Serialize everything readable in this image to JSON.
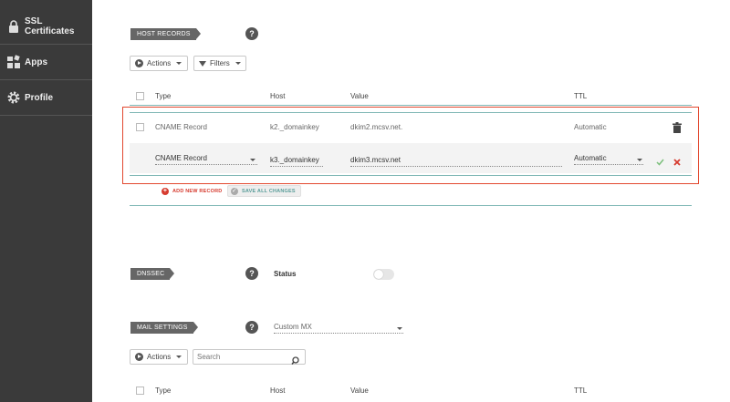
{
  "sidebar": {
    "items": [
      {
        "label": "SSL Certificates",
        "icon": "lock-icon"
      },
      {
        "label": "Apps",
        "icon": "apps-icon"
      },
      {
        "label": "Profile",
        "icon": "gear-icon"
      }
    ]
  },
  "host_records": {
    "tag": "HOST RECORDS",
    "help": "?",
    "actions_label": "Actions",
    "filters_label": "Filters",
    "columns": {
      "type": "Type",
      "host": "Host",
      "value": "Value",
      "ttl": "TTL"
    },
    "row": {
      "type": "CNAME Record",
      "host": "k2._domainkey",
      "value": "dkim2.mcsv.net.",
      "ttl": "Automatic"
    },
    "edit_row": {
      "type": "CNAME Record",
      "host": "k3._domainkey",
      "value": "dkim3.mcsv.net",
      "ttl": "Automatic"
    },
    "add_label": "ADD NEW RECORD",
    "save_label": "SAVE ALL CHANGES"
  },
  "dnssec": {
    "tag": "DNSSEC",
    "help": "?",
    "status_label": "Status",
    "enabled": false
  },
  "mail_settings": {
    "tag": "MAIL SETTINGS",
    "help": "?",
    "selected": "Custom MX",
    "actions_label": "Actions",
    "search_placeholder": "Search",
    "columns": {
      "type": "Type",
      "host": "Host",
      "value": "Value",
      "ttl": "TTL"
    }
  },
  "colors": {
    "highlight_border": "#e2482f",
    "teal_line": "#7fb7b5",
    "sidebar_bg": "#3a3a3a",
    "add_red": "#d63b2f"
  }
}
